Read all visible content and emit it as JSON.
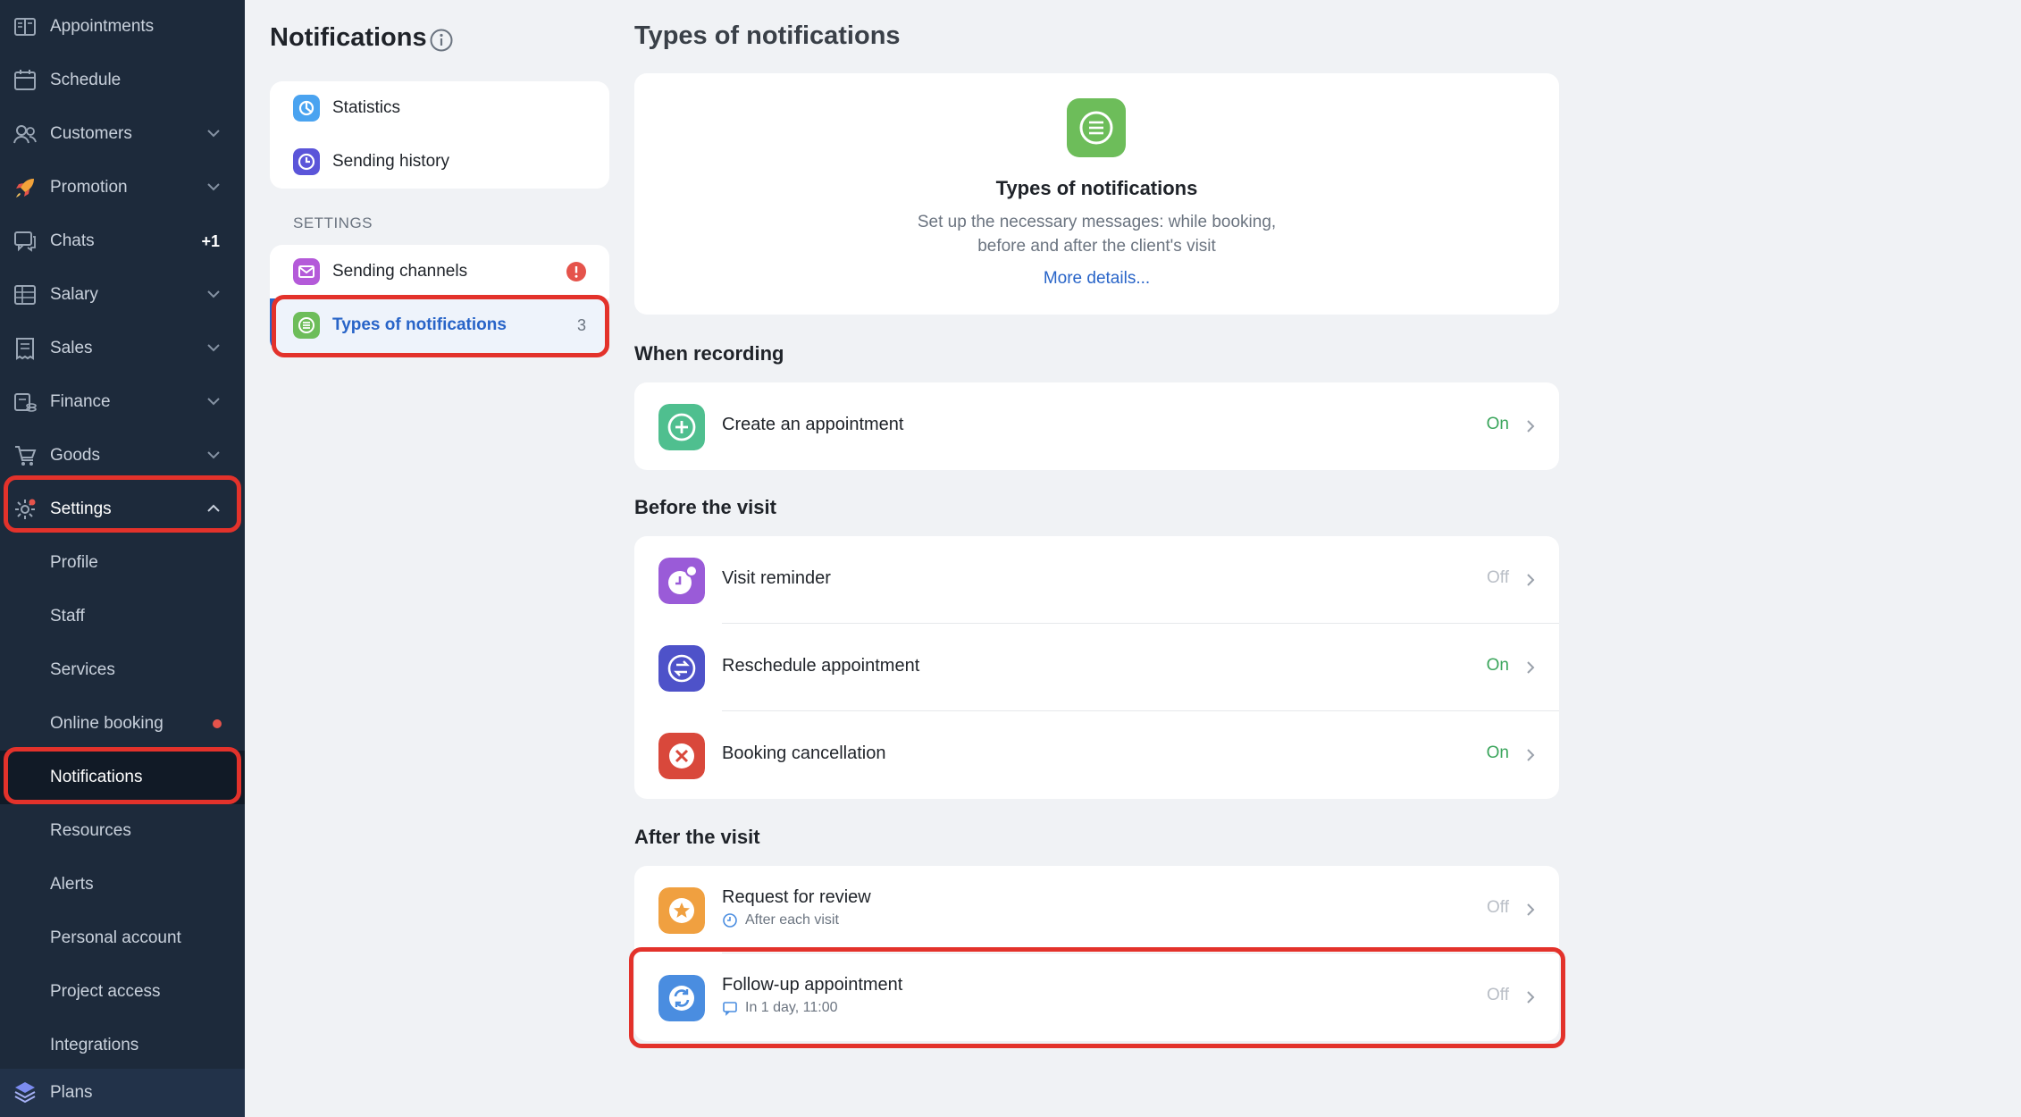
{
  "sidebar": {
    "items": [
      {
        "label": "Appointments",
        "icon": "book-icon",
        "chevron": false
      },
      {
        "label": "Schedule",
        "icon": "calendar-icon",
        "chevron": false
      },
      {
        "label": "Customers",
        "icon": "users-icon",
        "chevron": true
      },
      {
        "label": "Promotion",
        "icon": "rocket-icon",
        "chevron": true
      },
      {
        "label": "Chats",
        "icon": "chat-icon",
        "badge": "+1"
      },
      {
        "label": "Salary",
        "icon": "ledger-icon",
        "chevron": true
      },
      {
        "label": "Sales",
        "icon": "receipt-icon",
        "chevron": true
      },
      {
        "label": "Finance",
        "icon": "coins-icon",
        "chevron": true
      },
      {
        "label": "Goods",
        "icon": "cart-icon",
        "chevron": true
      },
      {
        "label": "Settings",
        "icon": "gear-icon",
        "chevron": true
      }
    ],
    "settings_sub": [
      {
        "label": "Profile"
      },
      {
        "label": "Staff"
      },
      {
        "label": "Services"
      },
      {
        "label": "Online booking"
      },
      {
        "label": "Notifications"
      },
      {
        "label": "Resources"
      },
      {
        "label": "Alerts"
      },
      {
        "label": "Personal account"
      },
      {
        "label": "Project access"
      },
      {
        "label": "Integrations"
      }
    ],
    "plans_label": "Plans"
  },
  "middle": {
    "title": "Notifications",
    "top_items": [
      {
        "label": "Statistics"
      },
      {
        "label": "Sending history"
      }
    ],
    "settings_heading": "SETTINGS",
    "settings_items": [
      {
        "label": "Sending channels"
      },
      {
        "label": "Types of notifications",
        "count": "3"
      }
    ]
  },
  "right": {
    "title": "Types of notifications",
    "intro": {
      "heading": "Types of notifications",
      "line1": "Set up the necessary messages: while booking,",
      "line2": "before and after the client's visit",
      "link": "More details..."
    },
    "sections": [
      {
        "title": "When recording",
        "rows": [
          {
            "title": "Create an appointment",
            "status": "On"
          }
        ]
      },
      {
        "title": "Before the visit",
        "rows": [
          {
            "title": "Visit reminder",
            "status": "Off"
          },
          {
            "title": "Reschedule appointment",
            "status": "On"
          },
          {
            "title": "Booking cancellation",
            "status": "On"
          }
        ]
      },
      {
        "title": "After the visit",
        "rows": [
          {
            "title": "Request for review",
            "sub": "After each visit",
            "status": "Off"
          },
          {
            "title": "Follow-up appointment",
            "sub": "In 1 day, 11:00",
            "status": "Off"
          }
        ]
      }
    ]
  },
  "colors": {
    "sidebar_bg": "#1d2a3b",
    "accent_blue": "#2864c8",
    "on_green": "#3ba55c",
    "highlight_red": "#e3322b"
  }
}
